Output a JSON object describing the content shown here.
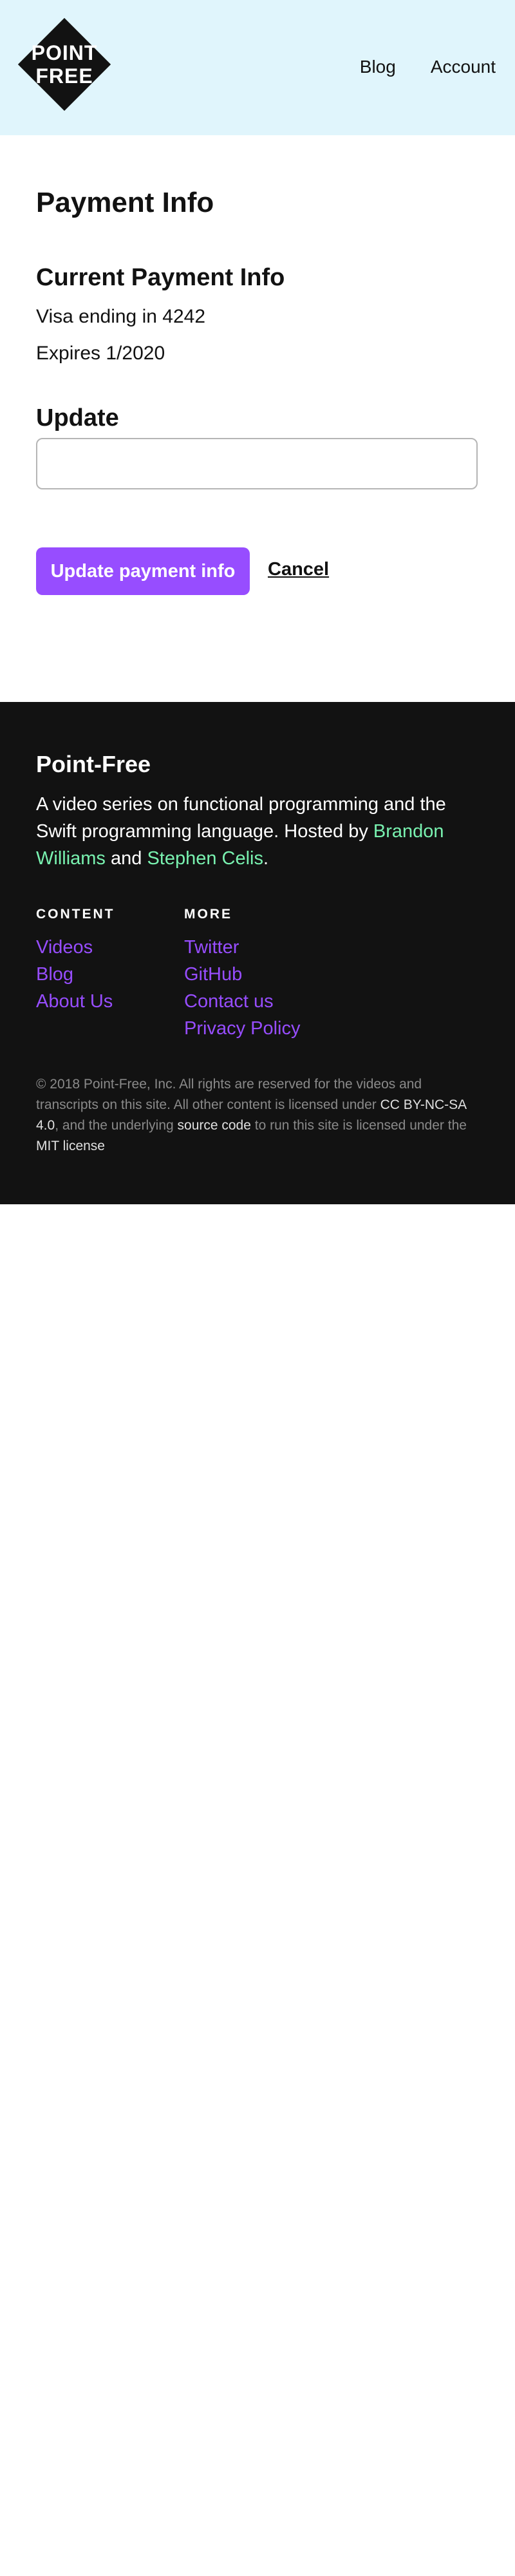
{
  "header": {
    "logo_line1": "POINT",
    "logo_line2": "FREE",
    "nav": {
      "blog": "Blog",
      "account": "Account"
    }
  },
  "main": {
    "title": "Payment Info",
    "current": {
      "heading": "Current Payment Info",
      "card": "Visa ending in 4242",
      "expires": "Expires 1/2020"
    },
    "update": {
      "heading": "Update",
      "card_value": "",
      "submit_label": "Update payment info",
      "cancel_label": "Cancel"
    }
  },
  "footer": {
    "brand": "Point-Free",
    "tagline_pre": "A video series on functional programming and the Swift programming language. Hosted by ",
    "host1": "Brandon Williams",
    "tagline_and": " and ",
    "host2": "Stephen Celis",
    "tagline_end": ".",
    "content_heading": "CONTENT",
    "content_links": [
      "Videos",
      "Blog",
      "About Us"
    ],
    "more_heading": "MORE",
    "more_links": [
      "Twitter",
      "GitHub",
      "Contact us",
      "Privacy Policy"
    ],
    "copyright_pre": "© 2018 Point-Free, Inc. All rights are reserved for the videos and transcripts on this site. All other content is licensed under ",
    "license_link": "CC BY-NC-SA 4.0",
    "copyright_mid": ", and the underlying ",
    "source_link": "source code",
    "copyright_mid2": " to run this site is licensed under the ",
    "mit_link": "MIT license"
  },
  "colors": {
    "header_bg": "#e0f5fc",
    "accent_purple": "#974dff",
    "host_green": "#79f2b0",
    "footer_bg": "#121212"
  }
}
